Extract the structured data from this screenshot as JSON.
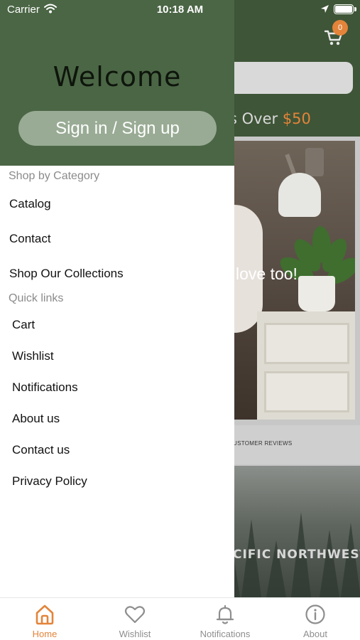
{
  "status_bar": {
    "carrier": "Carrier",
    "time": "10:18 AM"
  },
  "background": {
    "cart_count": "0",
    "promo_text": "s Over ",
    "promo_amount": "$50",
    "hero_text": "love too!",
    "reviews_text": "USTOMER REVIEWS",
    "forest_text": "CIFIC NORTHWEST!"
  },
  "drawer": {
    "welcome": "Welcome",
    "signin_label": "Sign in / Sign up",
    "shop_title": "Shop by Category",
    "shop_items": [
      "Catalog",
      "Contact",
      "Shop Our Collections"
    ],
    "quick_title": "Quick links",
    "quick_items": [
      "Cart",
      "Wishlist",
      "Notifications",
      "About us",
      "Contact us",
      "Privacy Policy"
    ]
  },
  "tab_bar": {
    "tabs": [
      {
        "label": "Home",
        "icon": "home-icon",
        "active": true
      },
      {
        "label": "Wishlist",
        "icon": "heart-icon",
        "active": false
      },
      {
        "label": "Notifications",
        "icon": "bell-icon",
        "active": false
      },
      {
        "label": "About",
        "icon": "info-icon",
        "active": false
      }
    ]
  },
  "colors": {
    "header_green": "#4b6645",
    "page_green": "#3e5537",
    "accent_orange": "#e3843a",
    "signin_button": "#99ab94"
  }
}
